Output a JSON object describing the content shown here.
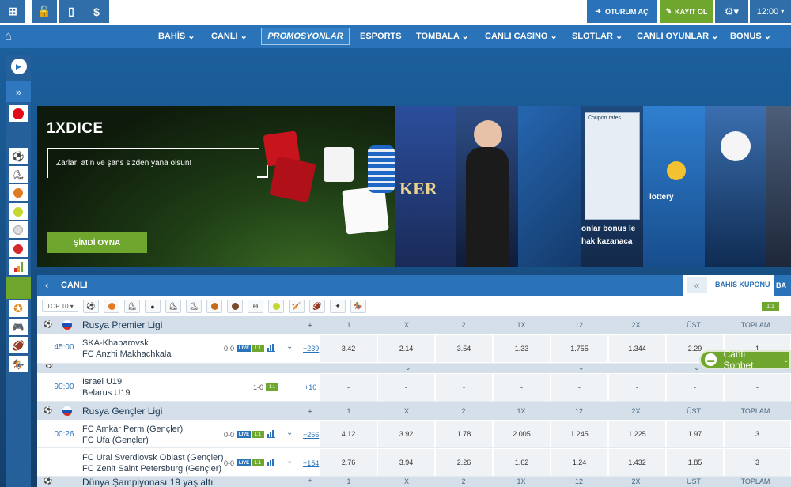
{
  "topbar": {
    "icons": [
      "windows-icon",
      "lock-icon",
      "mobile-icon",
      "dollar-icon"
    ],
    "icon_glyphs": [
      "⊞",
      "🔓",
      "▯",
      "$"
    ],
    "login_label": "OTURUM AÇ",
    "register_label": "KAYIT OL",
    "time": "12:00"
  },
  "nav": {
    "items": [
      {
        "label": "BAHİS ⌄"
      },
      {
        "label": "CANLI ⌄"
      },
      {
        "label": "ESPORTS"
      },
      {
        "label": "TOMBALA ⌄"
      },
      {
        "label": "CANLI CASINO ⌄"
      },
      {
        "label": "SLOTLAR ⌄"
      },
      {
        "label": "CANLI OYUNLAR ⌄"
      },
      {
        "label": "BONUS ⌄"
      }
    ],
    "promo_label": "PROMOSYONLAR"
  },
  "banner": {
    "title": "1XDICE",
    "subtitle": "Zarları atın ve şans sizden yana olsun!",
    "cta": "ŞİMDİ OYNA",
    "tile_texts": {
      "coupon": "Coupon rates",
      "bonus": "onlar bonus le",
      "kazan": "hak kazanaca",
      "poker": "KER",
      "lottery": "lottery"
    }
  },
  "live": {
    "title": "CANLI",
    "coupon_label": "BAHİS KUPONU",
    "coupon_tab2": "BA",
    "filter_label": "TOP 10 ▾",
    "field_text": "1:1"
  },
  "columns": [
    "1",
    "X",
    "2",
    "1X",
    "12",
    "2X",
    "ÜST",
    "TOPLAM"
  ],
  "plus_sign": "+",
  "leagues": [
    {
      "name": "Rusya Premier Ligi"
    },
    {
      "name": "Rusya Gençler Ligi"
    },
    {
      "name": "Dünya Şampiyonası 19 yaş altı"
    }
  ],
  "matches": [
    {
      "time": "45:00",
      "team1": "SKA-Khabarovsk",
      "team2": "FC Anzhi Makhachkala",
      "score": "0-0",
      "live": "LIVE",
      "more": "+239",
      "odds": [
        "3.42",
        "2.14",
        "3.54",
        "1.33",
        "1.755",
        "1.344",
        "2.29",
        "1"
      ]
    },
    {
      "time": "90:00",
      "team1": "Israel U19",
      "team2": "Belarus U19",
      "score": "1-0",
      "more": "+10",
      "odds": [
        "-",
        "-",
        "-",
        "-",
        "-",
        "-",
        "-",
        "-"
      ]
    },
    {
      "time": "00:26",
      "team1": "FC Amkar Perm (Gençler)",
      "team2": "FC Ufa (Gençler)",
      "score": "0-0",
      "live": "LIVE",
      "more": "+256",
      "odds": [
        "4.12",
        "3.92",
        "1.78",
        "2.005",
        "1.245",
        "1.225",
        "1.97",
        "3"
      ]
    },
    {
      "time": "",
      "team1": "FC Ural Sverdlovsk Oblast (Gençler)",
      "team2": "FC Zenit Saint Petersburg (Gençler)",
      "score": "0-0",
      "live": "LIVE",
      "more": "+154",
      "odds": [
        "2.76",
        "3.94",
        "2.26",
        "1.62",
        "1.24",
        "1.432",
        "1.85",
        "3"
      ]
    }
  ],
  "chat": {
    "label": "Canlı Sohbet",
    "arrow": "⌄"
  },
  "colors": {
    "primary": "#2a73b8",
    "green": "#6fa62e",
    "dark": "#143f6b"
  }
}
